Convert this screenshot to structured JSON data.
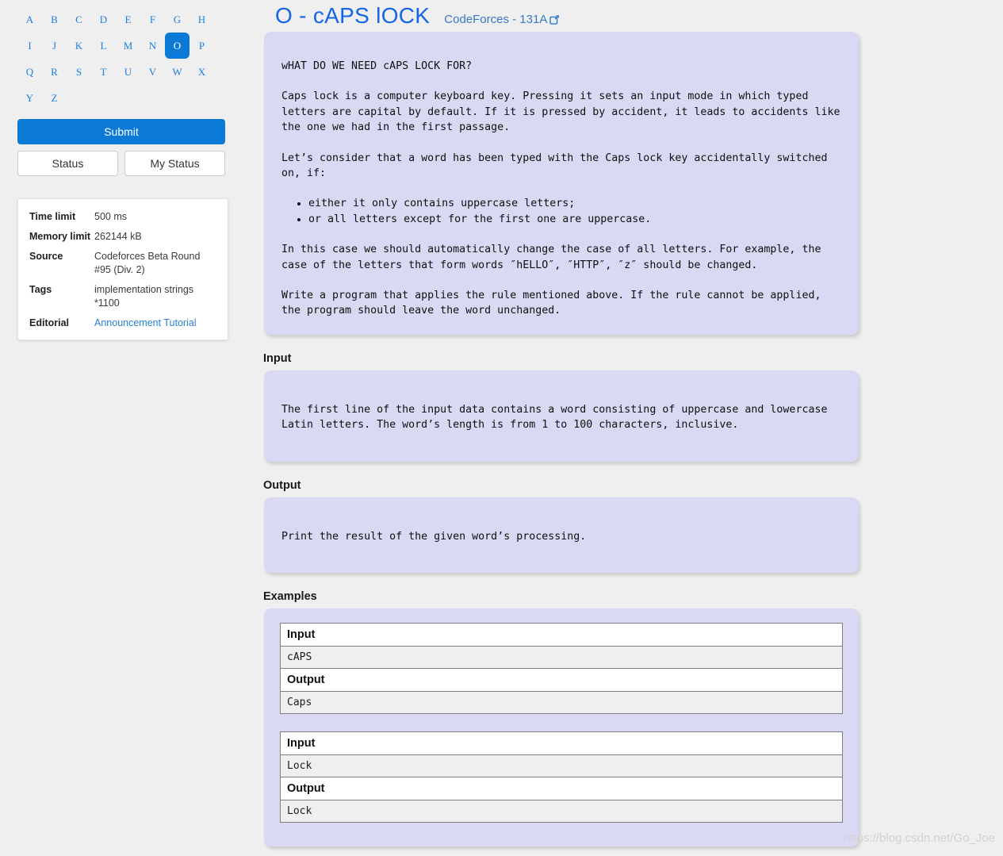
{
  "sidebar": {
    "letters": [
      "A",
      "B",
      "C",
      "D",
      "E",
      "F",
      "G",
      "H",
      "I",
      "J",
      "K",
      "L",
      "M",
      "N",
      "O",
      "P",
      "Q",
      "R",
      "S",
      "T",
      "U",
      "V",
      "W",
      "X",
      "Y",
      "Z"
    ],
    "selected_letter": "O",
    "submit_label": "Submit",
    "status_label": "Status",
    "my_status_label": "My Status",
    "info": {
      "rows": [
        {
          "key": "Time limit",
          "value": "500 ms"
        },
        {
          "key": "Memory limit",
          "value": "262144 kB"
        },
        {
          "key": "Source",
          "value": "Codeforces Beta Round #95 (Div. 2)"
        },
        {
          "key": "Tags",
          "value": "implementation strings *1100"
        }
      ],
      "editorial_key": "Editorial",
      "editorial_links": [
        "Announcement",
        "Tutorial"
      ]
    }
  },
  "header": {
    "title": "O - cAPS lOCK",
    "source": "CodeForces - 131A",
    "external_icon": "external-link-icon"
  },
  "statement": {
    "heading": "wHAT DO WE NEED cAPS LOCK FOR?",
    "p1": "Caps lock is a computer keyboard key. Pressing it sets an input mode in which typed letters are capital by default. If it is pressed by accident, it leads to accidents like the one we had in the first passage.",
    "p2": "Let’s consider that a word has been typed with the Caps lock key accidentally switched on, if:",
    "bullets": [
      "either it only contains uppercase letters;",
      "or all letters except for the first one are uppercase."
    ],
    "p3": "In this case we should automatically change the case of all letters. For example, the case of the letters that form words ″hELLO″, ″HTTP″, ″z″ should be changed.",
    "p4": "Write a program that applies the rule mentioned above. If the rule cannot be applied, the program should leave the word unchanged."
  },
  "input_section": {
    "heading": "Input",
    "text": "The first line of the input data contains a word consisting of uppercase and lowercase Latin letters. The word’s length is from 1 to 100 characters, inclusive."
  },
  "output_section": {
    "heading": "Output",
    "text": "Print the result of the given word’s processing."
  },
  "examples_section": {
    "heading": "Examples",
    "examples": [
      {
        "input_label": "Input",
        "input_value": "cAPS",
        "output_label": "Output",
        "output_value": "Caps"
      },
      {
        "input_label": "Input",
        "input_value": "Lock",
        "output_label": "Output",
        "output_value": "Lock"
      }
    ]
  },
  "watermark": "https://blog.csdn.net/Go_Joe",
  "colors": {
    "accent_blue": "#0b7ad6",
    "title_blue": "#1565e8",
    "link_blue": "#2a7fd4",
    "panel_lavender": "#d9d9f3",
    "page_bg": "#efefef",
    "table_row_bg": "#efefef"
  }
}
